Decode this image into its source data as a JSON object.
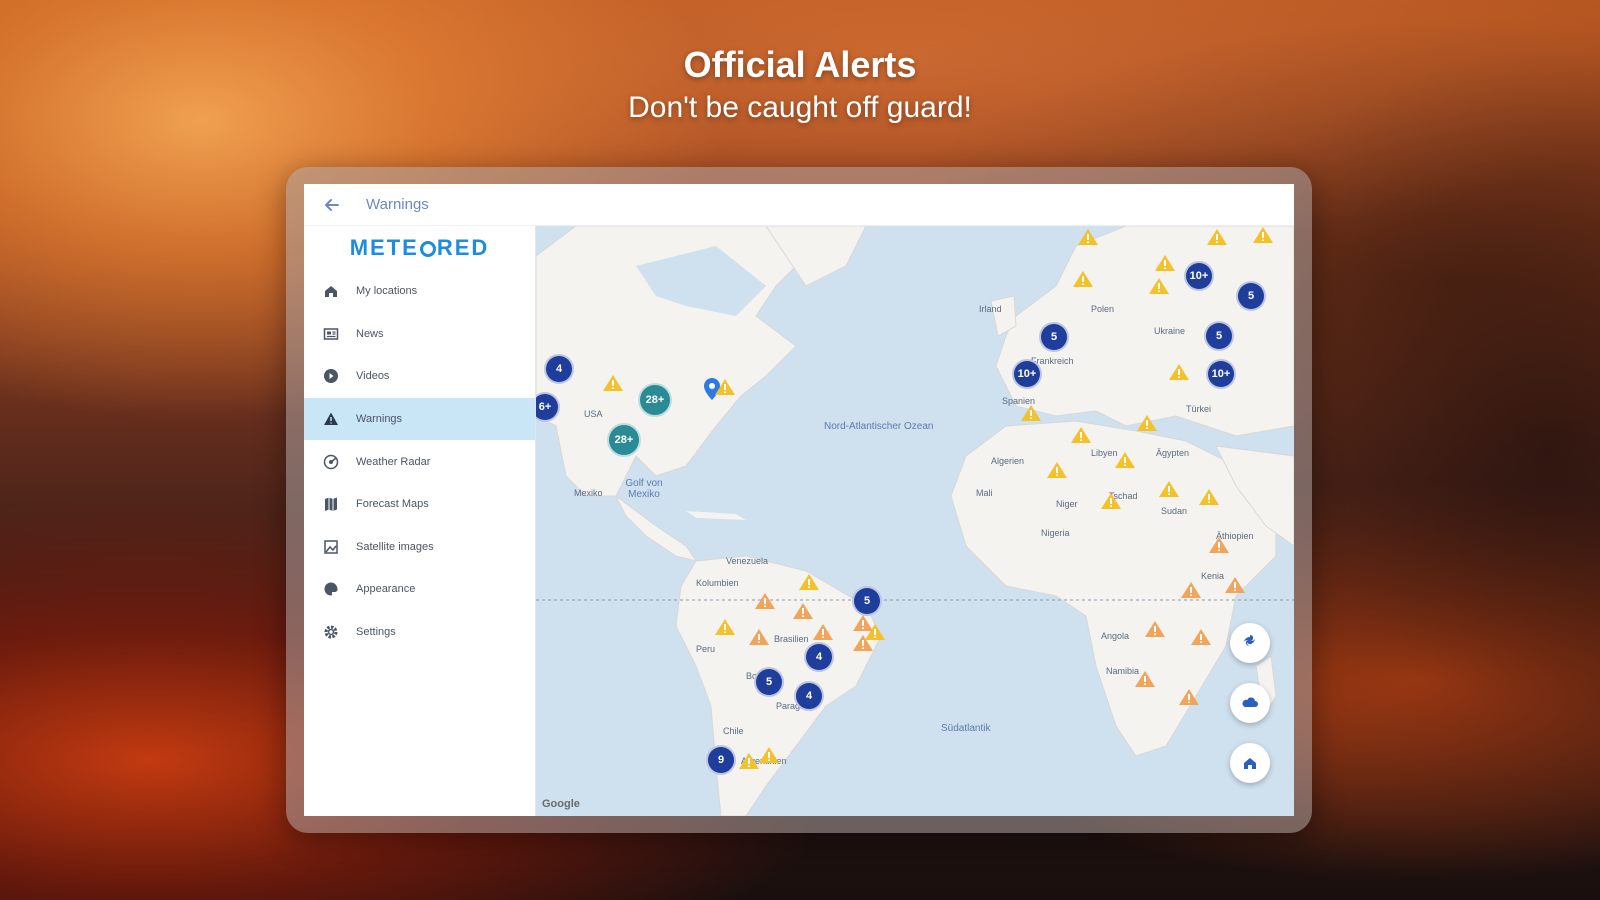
{
  "hero": {
    "title": "Official Alerts",
    "subtitle": "Don't be caught off guard!"
  },
  "appbar": {
    "title": "Warnings",
    "back_icon": "arrow-left-icon"
  },
  "sidebar": {
    "logo": "METEORED",
    "items": [
      {
        "label": "My locations",
        "icon": "home-icon",
        "active": false
      },
      {
        "label": "News",
        "icon": "news-icon",
        "active": false
      },
      {
        "label": "Videos",
        "icon": "play-icon",
        "active": false
      },
      {
        "label": "Warnings",
        "icon": "warning-icon",
        "active": true
      },
      {
        "label": "Weather Radar",
        "icon": "radar-icon",
        "active": false
      },
      {
        "label": "Forecast Maps",
        "icon": "map-icon",
        "active": false
      },
      {
        "label": "Satellite images",
        "icon": "satellite-icon",
        "active": false
      },
      {
        "label": "Appearance",
        "icon": "palette-icon",
        "active": false
      },
      {
        "label": "Settings",
        "icon": "gear-icon",
        "active": false
      }
    ]
  },
  "map": {
    "ocean_labels": [
      "Nord-Atlantischer Ozean",
      "Golf von Mexiko",
      "Südatlantik"
    ],
    "country_labels": [
      "USA",
      "Mexiko",
      "Venezuela",
      "Kolumbien",
      "Brasilien",
      "Peru",
      "Bolivien",
      "Paraguay",
      "Chile",
      "Argentinien",
      "Algerien",
      "Libyen",
      "Ägypten",
      "Mali",
      "Niger",
      "Tschad",
      "Sudan",
      "Nigeria",
      "Äthiopien",
      "Kenia",
      "Angola",
      "Namibia",
      "Polen",
      "Ukraine",
      "Frankreich",
      "Spanien",
      "Türkei",
      "Irland"
    ],
    "clusters": [
      {
        "label": "4",
        "kind": "blue"
      },
      {
        "label": "6+",
        "kind": "blue"
      },
      {
        "label": "28+",
        "kind": "teal"
      },
      {
        "label": "28+",
        "kind": "teal"
      },
      {
        "label": "5",
        "kind": "blue"
      },
      {
        "label": "4",
        "kind": "blue"
      },
      {
        "label": "5",
        "kind": "blue"
      },
      {
        "label": "4",
        "kind": "blue"
      },
      {
        "label": "9",
        "kind": "blue"
      },
      {
        "label": "5",
        "kind": "blue"
      },
      {
        "label": "10+",
        "kind": "blue"
      },
      {
        "label": "10+",
        "kind": "blue"
      },
      {
        "label": "5",
        "kind": "blue"
      },
      {
        "label": "5",
        "kind": "blue"
      },
      {
        "label": "10+",
        "kind": "blue"
      }
    ],
    "google_label": "Google",
    "colors": {
      "yellow_warning": "#f3c22b",
      "orange_warning": "#f0a55a",
      "cluster_blue": "#1f3e9b",
      "cluster_teal": "#2a8a96",
      "ocean": "#cfe0ee",
      "land": "#f4f3ef"
    },
    "fab_icons": [
      "hurricane-icon",
      "cloud-icon",
      "home-icon"
    ]
  }
}
